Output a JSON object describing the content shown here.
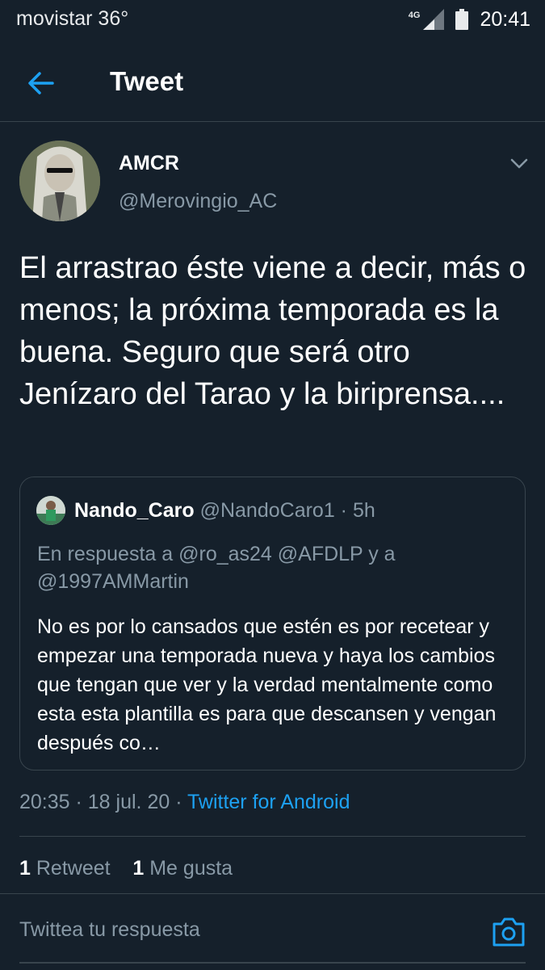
{
  "status_bar": {
    "carrier": "movistar",
    "temperature": "36°",
    "network": "4G",
    "time": "20:41"
  },
  "header": {
    "back_icon": "arrow-left-icon",
    "title": "Tweet"
  },
  "tweet": {
    "author_name": "AMCR",
    "author_handle": "@Merovingio_AC",
    "text": "El arrastrao éste viene a decir, más o menos; la próxima temporada es la buena. Seguro que será otro Jenízaro del Tarao y la biriprensa....",
    "time": "20:35",
    "date": "18 jul. 20",
    "source": "Twitter for Android",
    "separator": " · ",
    "retweets_count": "1",
    "retweets_label": "Retweet",
    "likes_count": "1",
    "likes_label": "Me gusta"
  },
  "quoted_tweet": {
    "author_name": "Nando_Caro",
    "author_handle": "@NandoCaro1",
    "age": "5h",
    "separator": " · ",
    "reply_to": "En respuesta a @ro_as24 @AFDLP y a @1997AMMartin",
    "text": "No es por lo cansados que estén es por recetear y empezar una temporada nueva y haya los cambios que tengan que ver y la verdad mentalmente como esta esta plantilla es para que descansen y vengan después co…"
  },
  "reply_bar": {
    "placeholder": "Twittea tu respuesta",
    "camera_icon": "camera-icon"
  },
  "colors": {
    "background": "#15202b",
    "accent": "#1da1f2",
    "secondary_text": "#8899a6",
    "border": "#38444d"
  }
}
